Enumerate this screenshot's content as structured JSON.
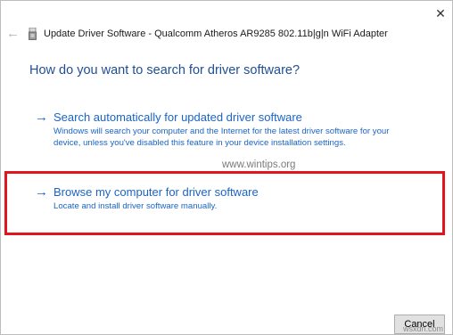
{
  "titlebar": {
    "title": "Update Driver Software - Qualcomm Atheros AR9285 802.11b|g|n WiFi Adapter",
    "back_icon": "back-arrow-icon",
    "close_label": "✕"
  },
  "main": {
    "heading": "How do you want to search for driver software?",
    "options": [
      {
        "title": "Search automatically for updated driver software",
        "description": "Windows will search your computer and the Internet for the latest driver software for your device, unless you've disabled this feature in your device installation settings."
      },
      {
        "title": "Browse my computer for driver software",
        "description": "Locate and install driver software manually."
      }
    ],
    "highlight_color": "#e2141e",
    "link_color": "#1a64c8"
  },
  "watermark": "www.wintips.org",
  "footer": {
    "cancel_label": "Cancel",
    "corner_watermark": "wsxdn.com"
  }
}
